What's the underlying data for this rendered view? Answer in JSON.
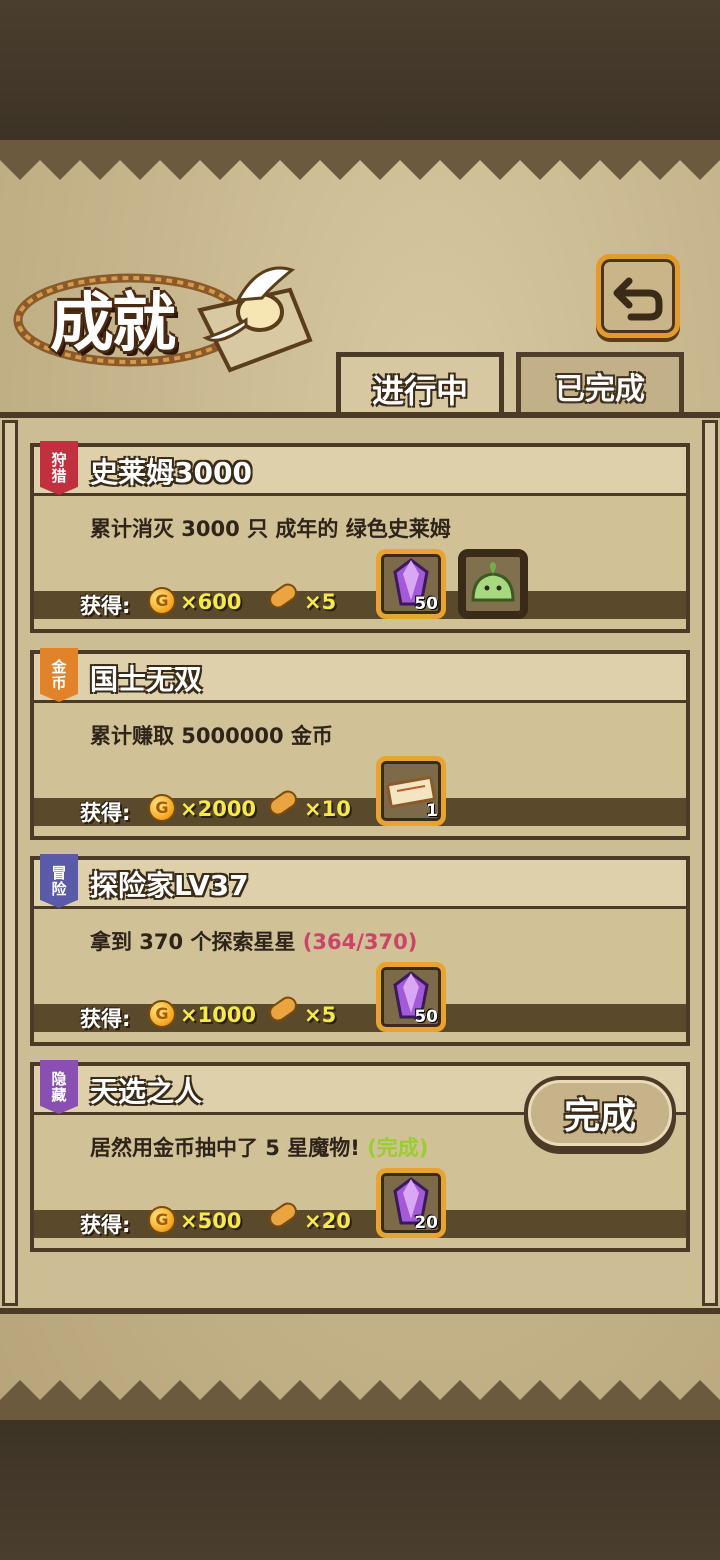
{
  "title": "成就",
  "tabs": {
    "active": "进行中",
    "inactive": "已完成"
  },
  "reward_label": "获得:",
  "coin_symbol": "G",
  "colors": {
    "accent": "#e9a331",
    "progress": "#cc4468",
    "done": "#9ccd30",
    "reward_value": "#f7e94a"
  },
  "achievements": [
    {
      "badge": "狩猎",
      "badge_color": "#c0303f",
      "title": "史莱姆3000",
      "desc": "累计消灭 3000 只 成年的 绿色史莱姆",
      "progress": "",
      "gold": "×600",
      "bread": "×5",
      "items": [
        {
          "icon": "crystal-icon",
          "count": "50"
        },
        {
          "icon": "green-slime-icon",
          "count": ""
        }
      ]
    },
    {
      "badge": "金币",
      "badge_color": "#e2832a",
      "title": "国士无双",
      "desc": "累计赚取 5000000 金币",
      "progress": "",
      "gold": "×2000",
      "bread": "×10",
      "items": [
        {
          "icon": "ticket-icon",
          "count": "1"
        }
      ]
    },
    {
      "badge": "冒险",
      "badge_color": "#5a5aa8",
      "title": "探险家LV37",
      "desc": "拿到 370 个探索星星",
      "progress": "(364/370)",
      "gold": "×1000",
      "bread": "×5",
      "items": [
        {
          "icon": "crystal-icon",
          "count": "50"
        }
      ]
    },
    {
      "badge": "隐藏",
      "badge_color": "#8a4fb3",
      "title": "天选之人",
      "desc": "居然用金币抽中了 5 星魔物!",
      "progress": "(完成)",
      "gold": "×500",
      "bread": "×20",
      "items": [
        {
          "icon": "crystal-icon",
          "count": "20"
        }
      ]
    }
  ],
  "complete_button": "完成"
}
